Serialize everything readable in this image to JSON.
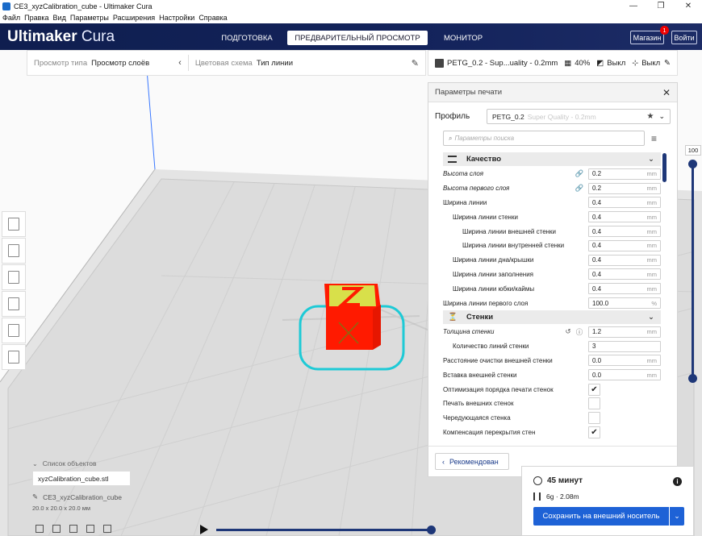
{
  "window": {
    "title": "CE3_xyzCalibration_cube - Ultimaker Cura",
    "minimize": "—",
    "restore": "❐",
    "close": "✕"
  },
  "menu": [
    "Файл",
    "Правка",
    "Вид",
    "Параметры",
    "Расширения",
    "Настройки",
    "Справка"
  ],
  "header": {
    "logo_bold": "Ultimaker",
    "logo_light": " Cura",
    "tabs": [
      {
        "label": "ПОДГОТОВКА"
      },
      {
        "label": "ПРЕДВАРИТЕЛЬНЫЙ ПРОСМОТР"
      },
      {
        "label": "МОНИТОР"
      }
    ],
    "marketplace": "Магазин",
    "marketplace_badge": "1",
    "signin": "Войти"
  },
  "viewbar": {
    "view_type_label": "Просмотр типа",
    "view_type_value": "Просмотр слоёв",
    "color_scheme_label": "Цветовая схема",
    "color_scheme_value": "Тип линии"
  },
  "printbar": {
    "profile": "PETG_0.2 - Sup...uality - 0.2mm",
    "infill": "40%",
    "support": "Выкл",
    "adhesion": "Выкл"
  },
  "panel": {
    "title": "Параметры печати",
    "profile_label": "Профиль",
    "profile_value": "PETG_0.2",
    "profile_sub": "Super Quality - 0.2mm",
    "search_placeholder": "Параметры поиска",
    "recommended": "Рекомендован",
    "categories": {
      "quality": "Качество",
      "walls": "Стенки"
    },
    "quality_rows": [
      {
        "name": "Высота слоя",
        "value": "0.2",
        "unit": "mm"
      },
      {
        "name": "Высота первого слоя",
        "value": "0.2",
        "unit": "mm"
      },
      {
        "name": "Ширина линии",
        "value": "0.4",
        "unit": "mm"
      },
      {
        "name": "Ширина линии стенки",
        "value": "0.4",
        "unit": "mm"
      },
      {
        "name": "Ширина линии внешней стенки",
        "value": "0.4",
        "unit": "mm"
      },
      {
        "name": "Ширина линии внутренней стенки",
        "value": "0.4",
        "unit": "mm"
      },
      {
        "name": "Ширина линии дна/крышки",
        "value": "0.4",
        "unit": "mm"
      },
      {
        "name": "Ширина линии заполнения",
        "value": "0.4",
        "unit": "mm"
      },
      {
        "name": "Ширина линии юбки/каймы",
        "value": "0.4",
        "unit": "mm"
      },
      {
        "name": "Ширина линии первого слоя",
        "value": "100.0",
        "unit": "%"
      }
    ],
    "wall_rows": [
      {
        "name": "Толщина стенки",
        "value": "1.2",
        "unit": "mm"
      },
      {
        "name": "Количество линий стенки",
        "value": "3",
        "unit": ""
      },
      {
        "name": "Расстояние очистки внешней стенки",
        "value": "0.0",
        "unit": "mm"
      },
      {
        "name": "Вставка внешней стенки",
        "value": "0.0",
        "unit": "mm"
      }
    ],
    "check_rows": [
      {
        "name": "Оптимизация порядка печати стенок",
        "checked": true
      },
      {
        "name": "Печать внешних стенок",
        "checked": false
      },
      {
        "name": "Чередующаяся стенка",
        "checked": false
      },
      {
        "name": "Компенсация перекрытия стен",
        "checked": true
      }
    ]
  },
  "layer_slider": {
    "value": "100"
  },
  "objects": {
    "header": "Список объектов",
    "file": "xyzCalibration_cube.stl",
    "name": "CE3_xyzCalibration_cube",
    "dimensions": "20.0 x 20.0 x 20.0 мм"
  },
  "print_info": {
    "time": "45 минут",
    "material": "6g · 2.08m",
    "save": "Сохранить на внешний носитель"
  },
  "colors": {
    "header": "#13235b",
    "accent": "#1e62d6",
    "slider": "#1e3778",
    "cube": "#ff1a00",
    "infill": "#d8e04a",
    "skirt": "#1ecad6"
  }
}
